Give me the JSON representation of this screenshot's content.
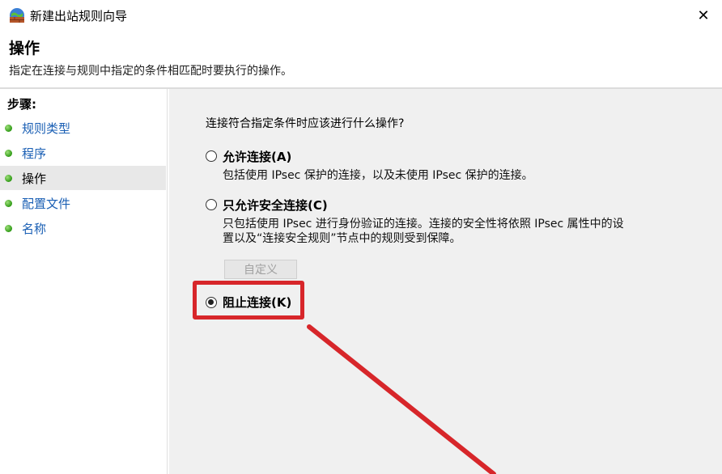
{
  "window": {
    "title": "新建出站规则向导",
    "close_glyph": "✕"
  },
  "header": {
    "title": "操作",
    "description": "指定在连接与规则中指定的条件相匹配时要执行的操作。"
  },
  "sidebar": {
    "title": "步骤:",
    "items": [
      {
        "label": "规则类型"
      },
      {
        "label": "程序"
      },
      {
        "label": "操作"
      },
      {
        "label": "配置文件"
      },
      {
        "label": "名称"
      }
    ]
  },
  "main": {
    "question": "连接符合指定条件时应该进行什么操作?",
    "options": [
      {
        "label": "允许连接(A)",
        "description": [
          "包括使用 IPsec 保护的连接，以及未使用 IPsec 保护的连接。"
        ],
        "selected": false
      },
      {
        "label": "只允许安全连接(C)",
        "description": [
          "只包括使用 IPsec 进行身份验证的连接。连接的安全性将依照 IPsec 属性中的设",
          "置以及“连接安全规则”节点中的规则受到保障。"
        ],
        "selected": false
      },
      {
        "label": "阻止连接(K)",
        "selected": true
      }
    ],
    "custom_button": "自定义"
  },
  "colors": {
    "annotation": "#d7262a",
    "link": "#1a5fb4",
    "panel": "#f0f0f0"
  }
}
